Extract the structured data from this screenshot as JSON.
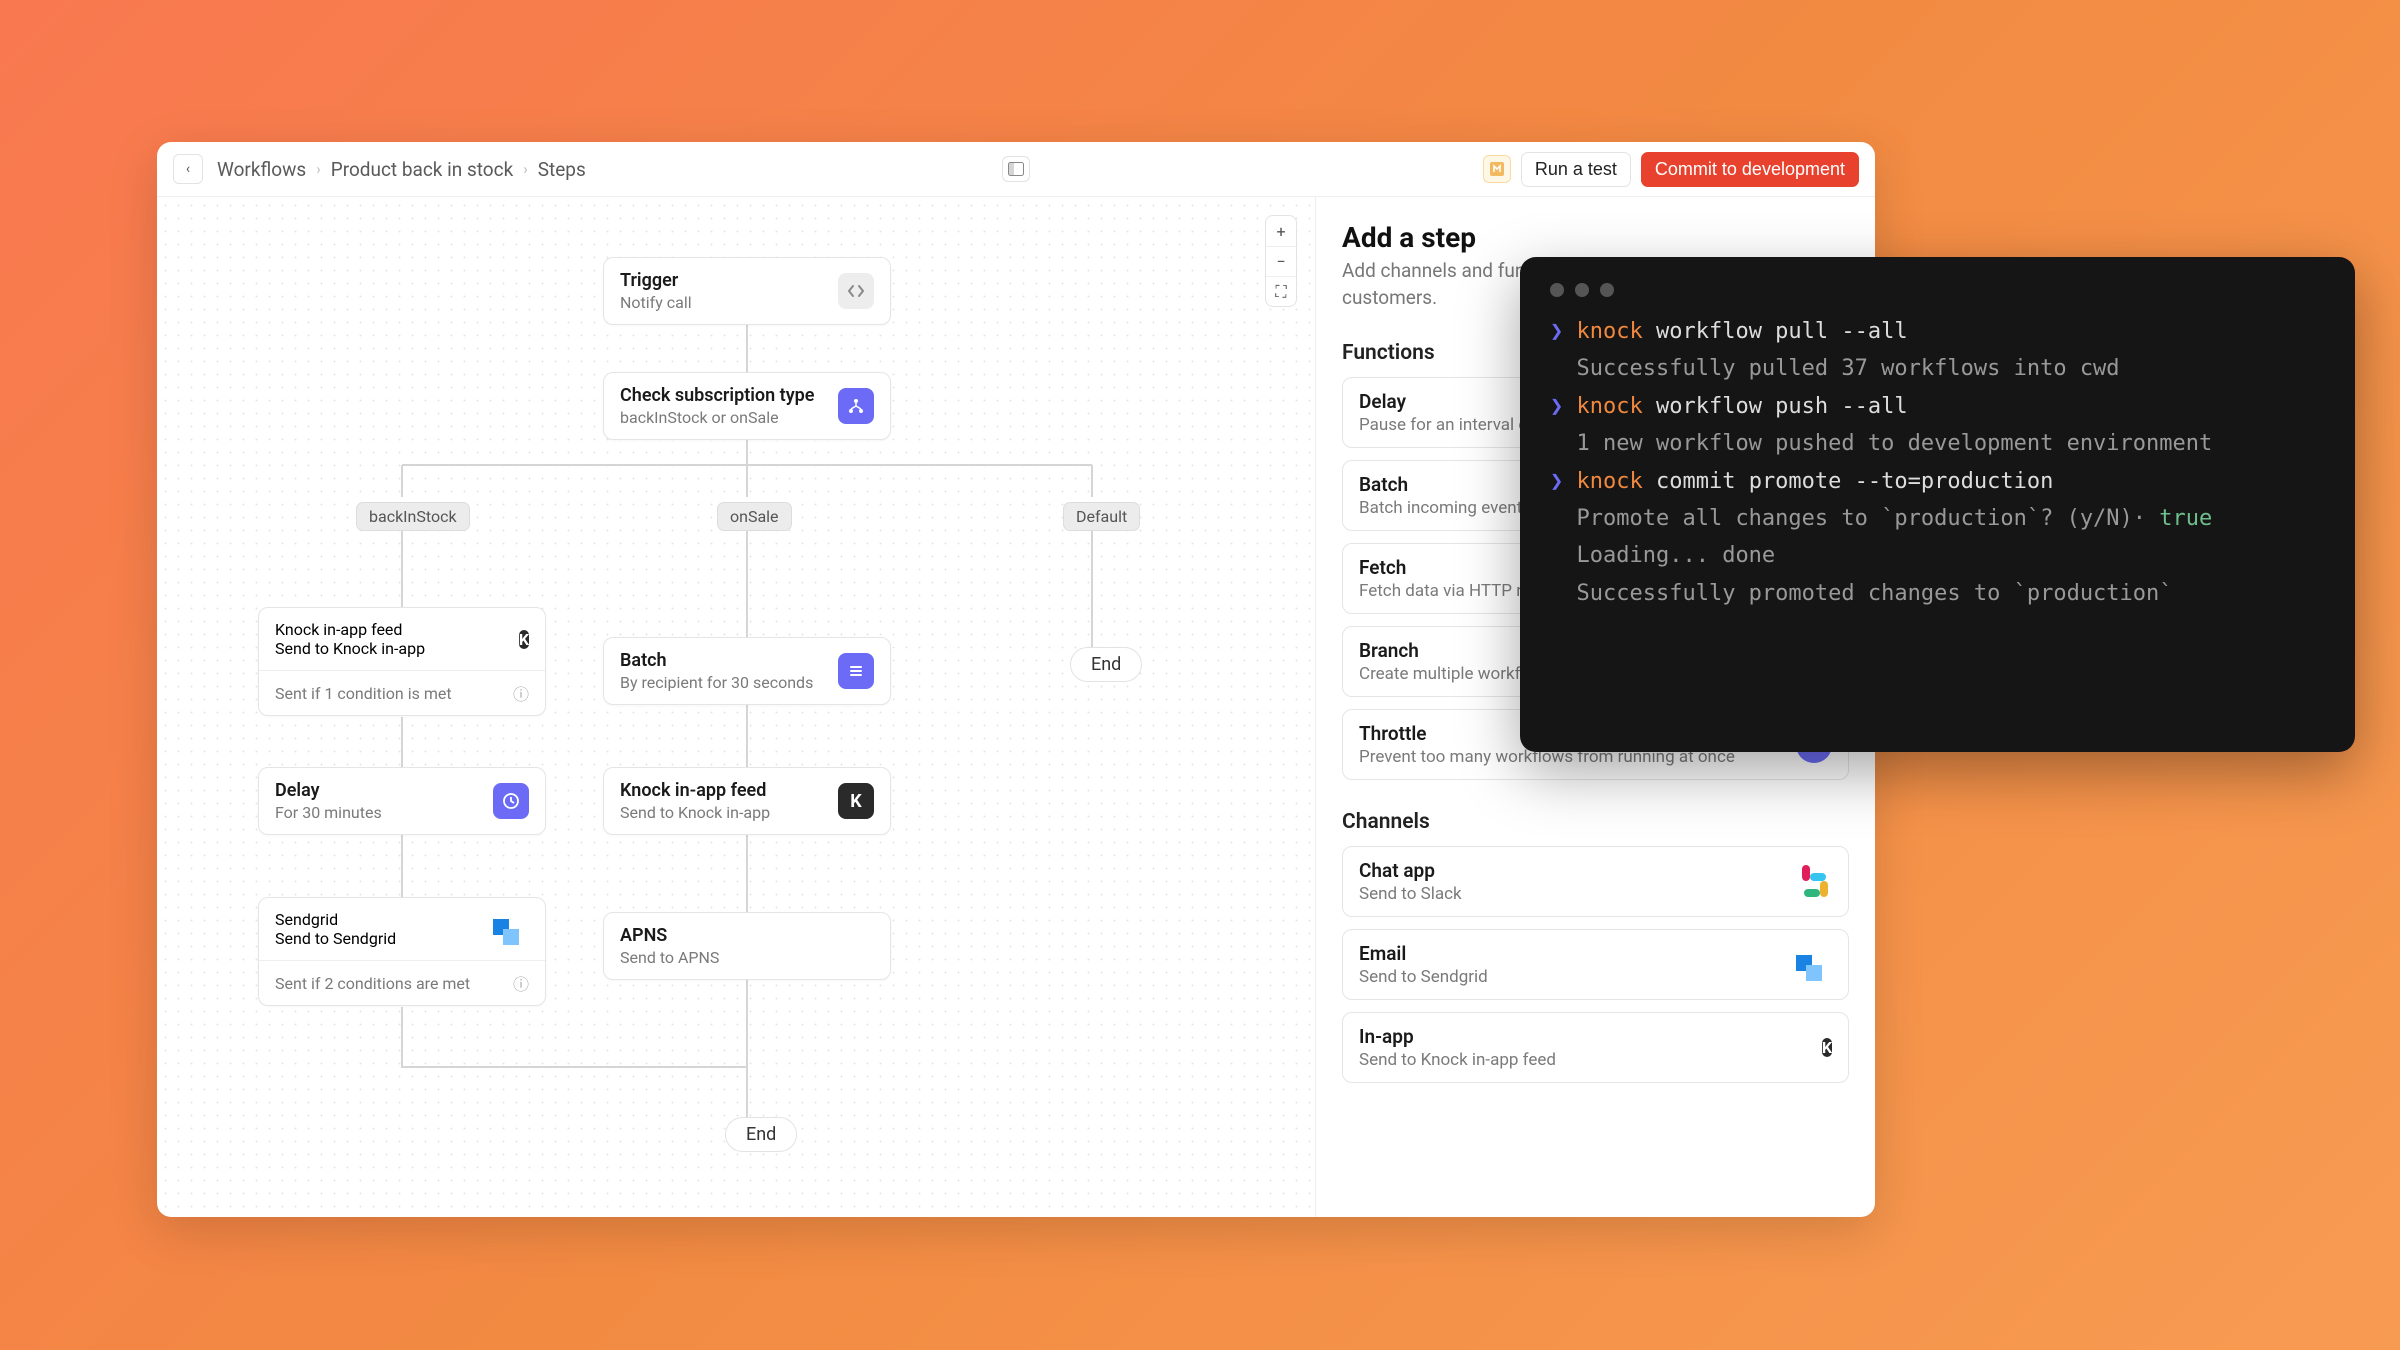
{
  "header": {
    "breadcrumb": [
      "Workflows",
      "Product back in stock",
      "Steps"
    ],
    "run_test": "Run a test",
    "commit": "Commit to development"
  },
  "nodes": {
    "trigger": {
      "title": "Trigger",
      "sub": "Notify call"
    },
    "check": {
      "title": "Check subscription type",
      "sub": "backInStock or onSale"
    },
    "tags": {
      "backInStock": "backInStock",
      "onSale": "onSale",
      "default": "Default"
    },
    "knock1": {
      "title": "Knock in-app feed",
      "sub": "Send to Knock in-app",
      "cond": "Sent if 1 condition is met"
    },
    "batch": {
      "title": "Batch",
      "sub": "By recipient for 30 seconds"
    },
    "delay": {
      "title": "Delay",
      "sub": "For 30 minutes"
    },
    "knock2": {
      "title": "Knock in-app feed",
      "sub": "Send to Knock in-app"
    },
    "sendgrid": {
      "title": "Sendgrid",
      "sub": "Send to Sendgrid",
      "cond": "Sent if 2 conditions are met"
    },
    "apns": {
      "title": "APNS",
      "sub": "Send to APNS"
    },
    "end1": "End",
    "end2": "End"
  },
  "sidebar": {
    "title": "Add a step",
    "desc": "Add channels and functions to send messages to your customers.",
    "functions_title": "Functions",
    "functions": [
      {
        "t": "Delay",
        "s": "Pause for an interval of time"
      },
      {
        "t": "Batch",
        "s": "Batch incoming events together"
      },
      {
        "t": "Fetch",
        "s": "Fetch data via HTTP request"
      },
      {
        "t": "Branch",
        "s": "Create multiple workflow paths"
      },
      {
        "t": "Throttle",
        "s": "Prevent too many workflows from running at once"
      }
    ],
    "channels_title": "Channels",
    "channels": [
      {
        "t": "Chat app",
        "s": "Send to Slack"
      },
      {
        "t": "Email",
        "s": "Send to Sendgrid"
      },
      {
        "t": "In-app",
        "s": "Send to Knock in-app feed"
      }
    ]
  },
  "terminal": {
    "lines": [
      {
        "cmd": "knock",
        "rest": " workflow pull --all"
      },
      {
        "out": "Successfully pulled 37 workflows into cwd"
      },
      {
        "cmd": "knock",
        "rest": " workflow push --all"
      },
      {
        "out": "1 new workflow pushed to development environment"
      },
      {
        "cmd": "knock",
        "rest": " commit promote --to=production"
      },
      {
        "out": "Promote all changes to `production`? (y/N)·",
        "val": " true"
      },
      {
        "out": "Loading... done"
      },
      {
        "out": "Successfully promoted changes to `production`"
      }
    ]
  }
}
